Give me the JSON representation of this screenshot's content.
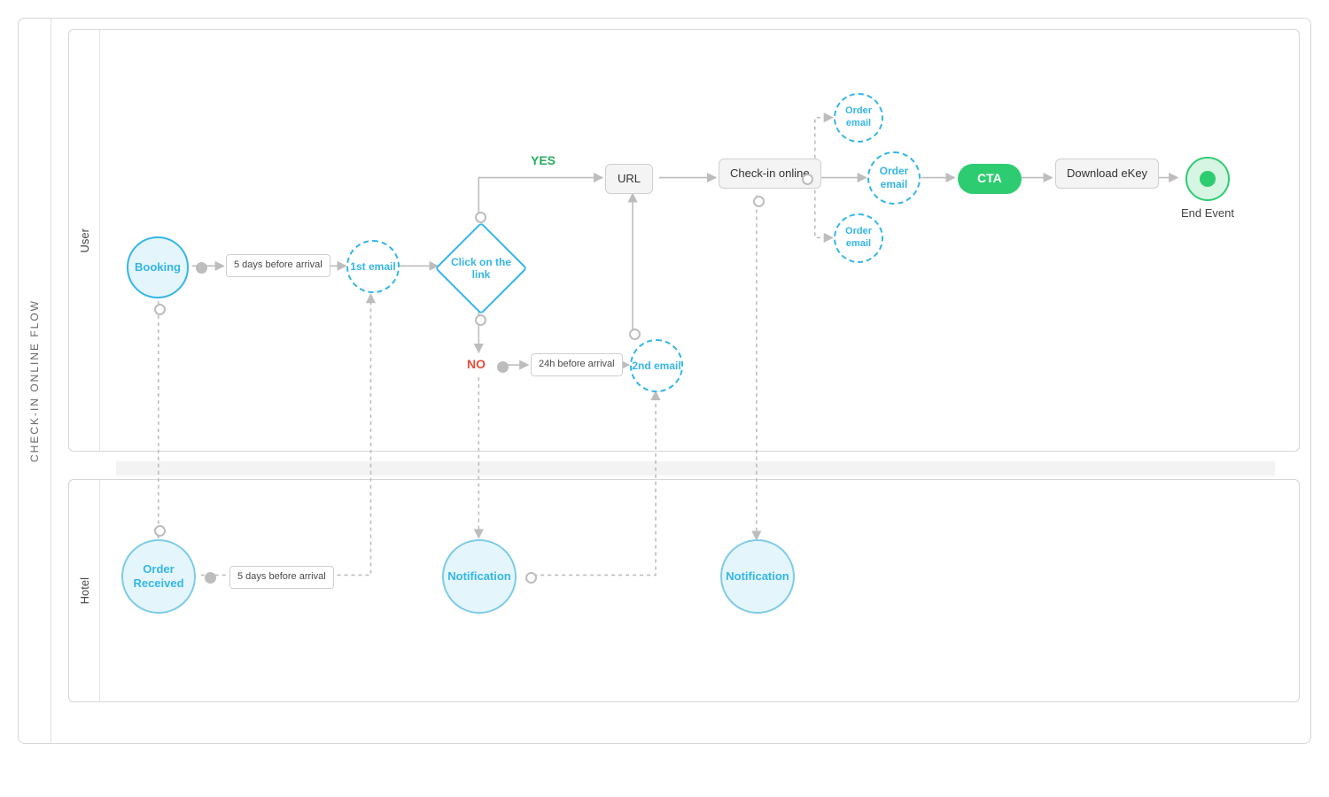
{
  "diagram": {
    "title": "CHECK-IN ONLINE FLOW",
    "lanes": {
      "user": "User",
      "hotel": "Hotel"
    },
    "nodes": {
      "booking": "Booking",
      "tag_5days_a": "5 days before arrival",
      "first_email": "1st email",
      "decision": "Click on the link",
      "yes": "YES",
      "no": "NO",
      "tag_24h": "24h before arrival",
      "second_email": "2nd email",
      "url": "URL",
      "checkin": "Check-in online",
      "order_email_top": "Order email",
      "order_email_mid": "Order email",
      "order_email_bot": "Order email",
      "cta": "CTA",
      "download": "Download eKey",
      "end": "End Event",
      "order_received": "Order Received",
      "tag_5days_b": "5 days before arrival",
      "notif1": "Notification",
      "notif2": "Notification"
    }
  }
}
